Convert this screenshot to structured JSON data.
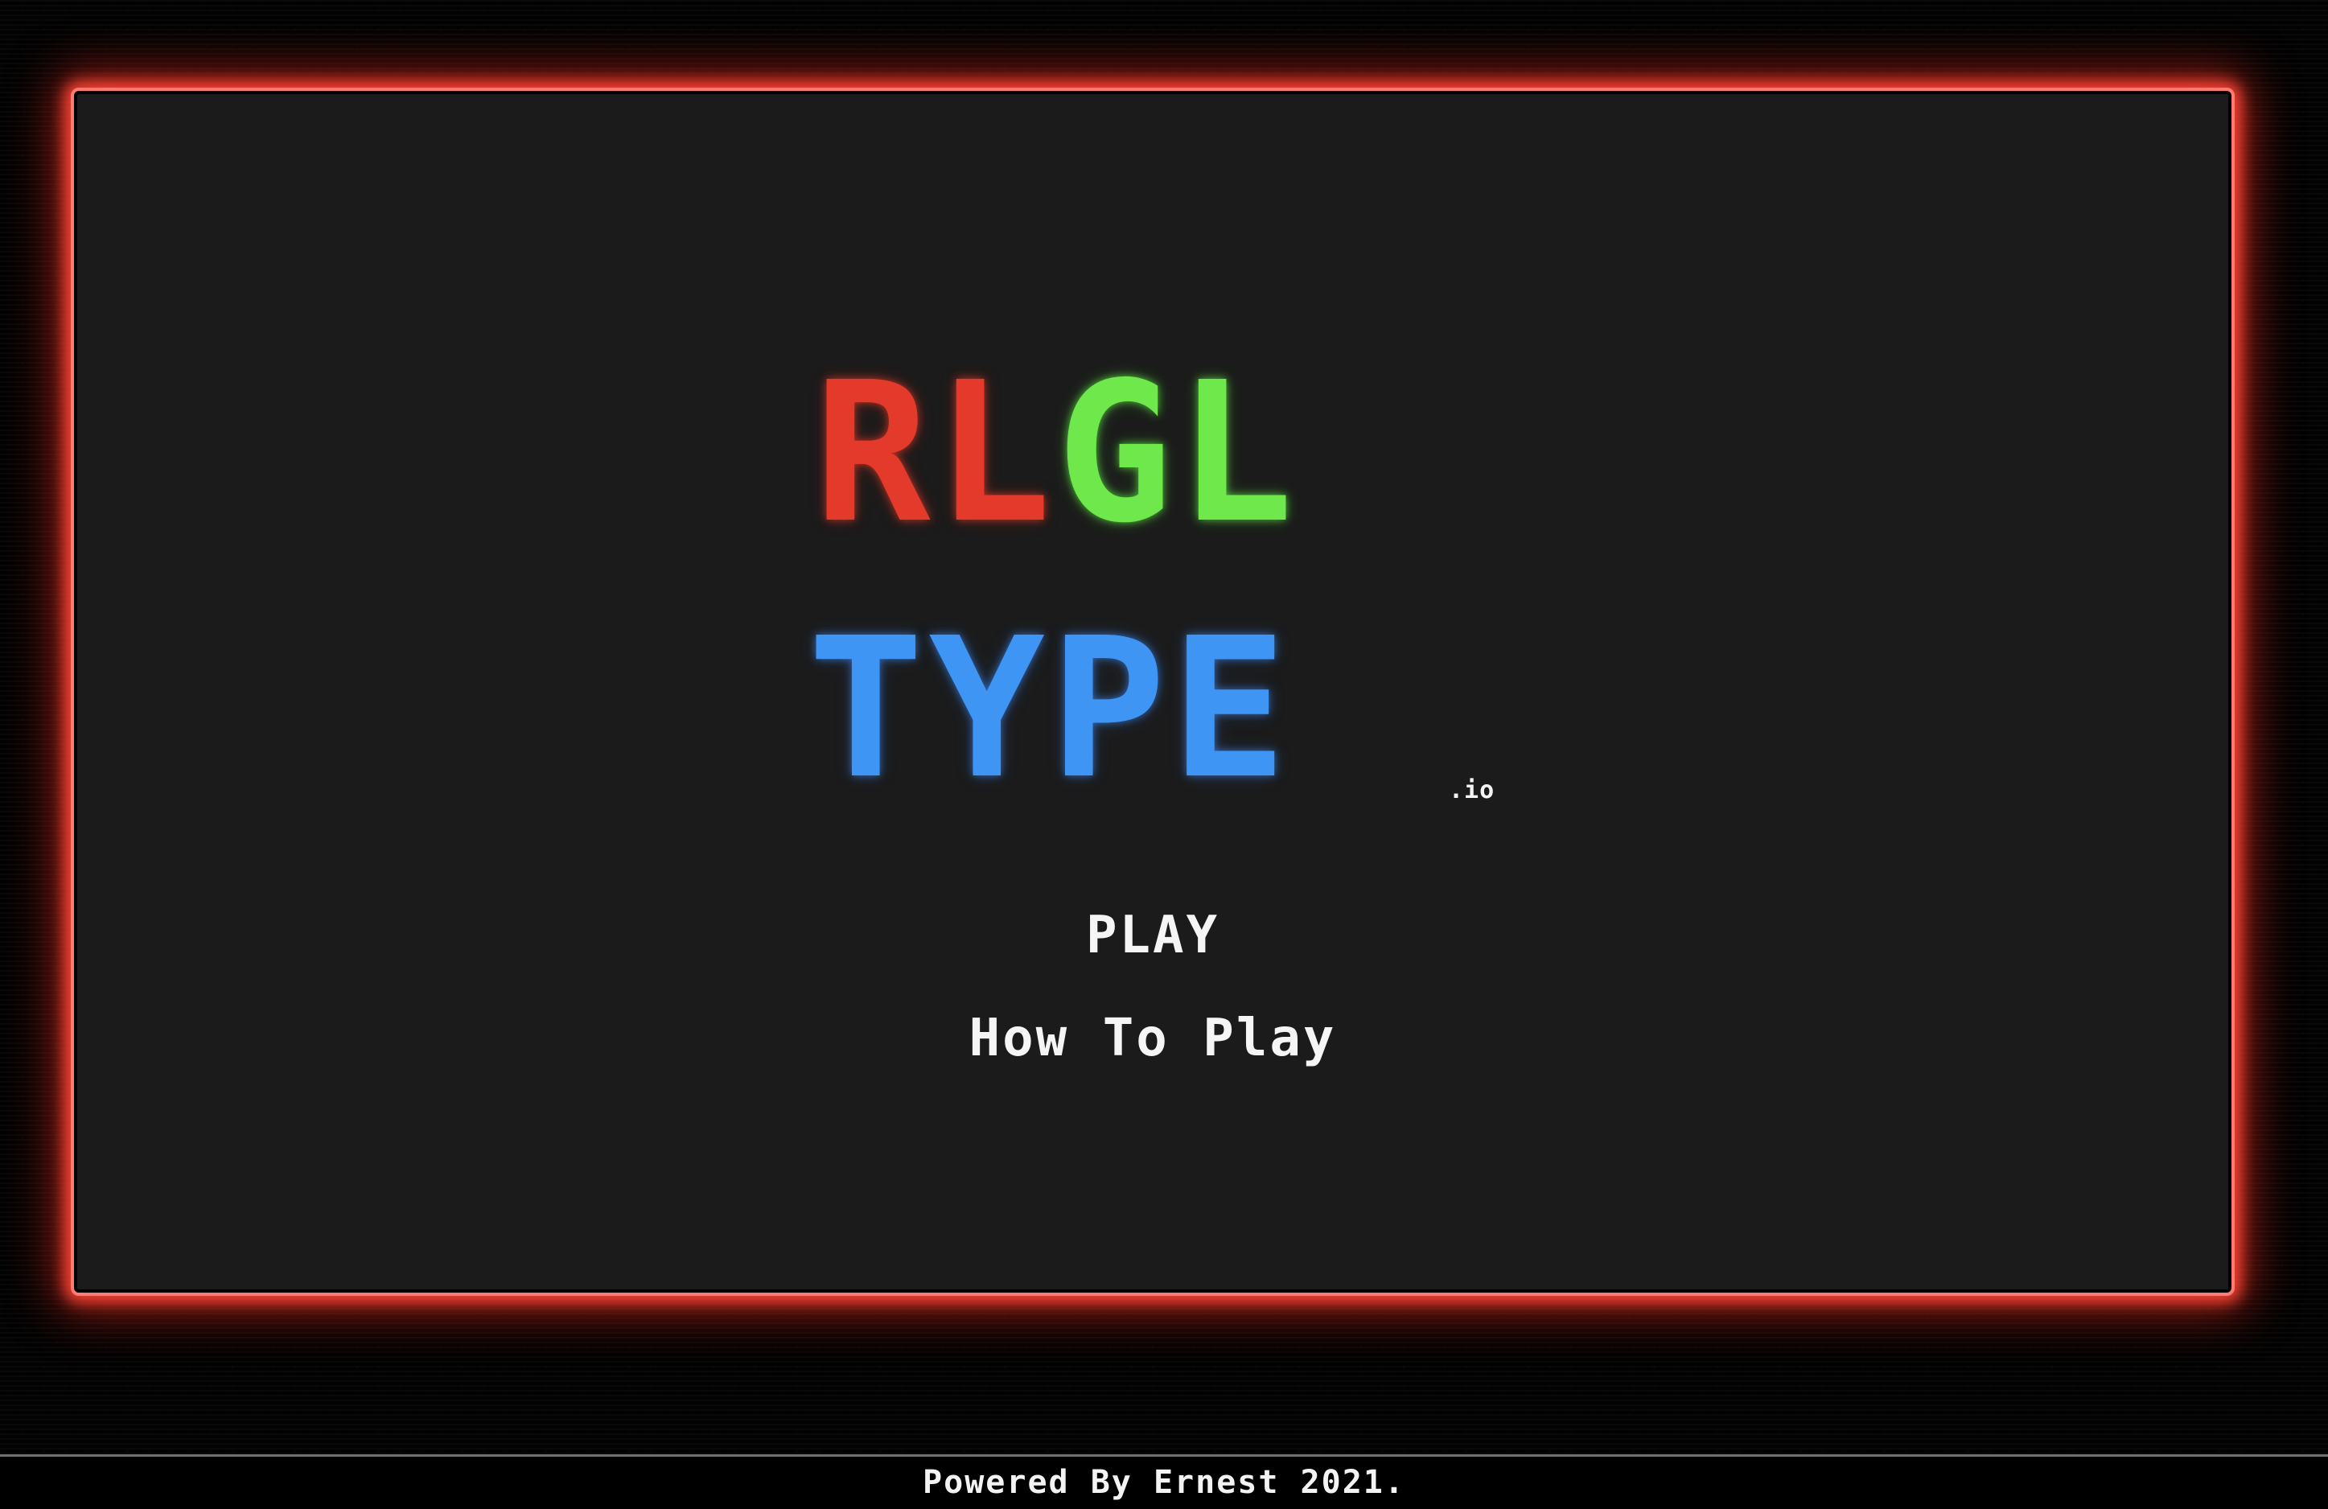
{
  "logo": {
    "red_text": "RL",
    "green_text": "GL",
    "blue_text": "TYPE",
    "suffix": ".io",
    "colors": {
      "red": "#e33a2b",
      "green": "#6ee84a",
      "blue": "#3f95f4"
    }
  },
  "menu": {
    "play_label": "PLAY",
    "how_to_play_label": "How To Play"
  },
  "footer": {
    "text": "Powered By Ernest 2021."
  },
  "theme": {
    "frame_border": "#ff7a70",
    "frame_background": "#1b1b1b",
    "page_background": "#020202",
    "text": "#f5f5f5"
  }
}
